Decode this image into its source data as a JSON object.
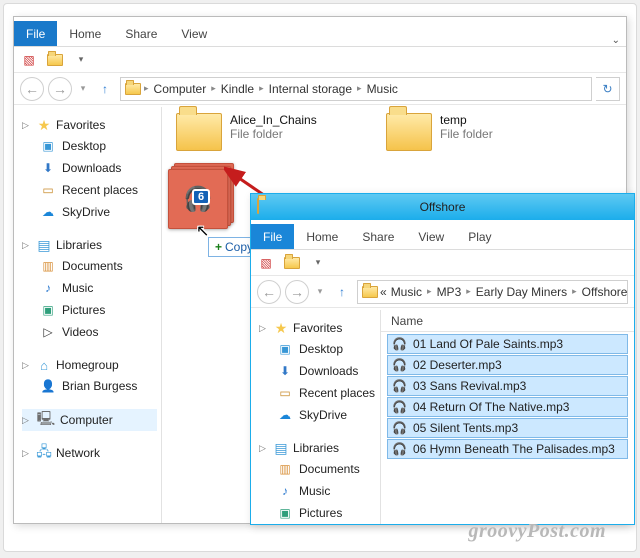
{
  "watermark": "groovyPost.com",
  "main": {
    "ribbon": {
      "file": "File",
      "tabs": [
        "Home",
        "Share",
        "View"
      ]
    },
    "address": [
      "Computer",
      "Kindle",
      "Internal storage",
      "Music"
    ],
    "nav": {
      "favorites": {
        "label": "Favorites",
        "items": [
          "Desktop",
          "Downloads",
          "Recent places",
          "SkyDrive"
        ]
      },
      "libraries": {
        "label": "Libraries",
        "items": [
          "Documents",
          "Music",
          "Pictures",
          "Videos"
        ]
      },
      "homegroup": {
        "label": "Homegroup",
        "items": [
          "Brian Burgess"
        ]
      },
      "computer": {
        "label": "Computer"
      },
      "network": {
        "label": "Network"
      }
    },
    "tiles": [
      {
        "name": "Alice_In_Chains",
        "kind": "File folder"
      },
      {
        "name": "temp",
        "kind": "File folder"
      }
    ],
    "drag": {
      "count": "6",
      "hint": "Copy"
    }
  },
  "sub": {
    "title": "Offshore",
    "ribbon": {
      "file": "File",
      "tabs": [
        "Home",
        "Share",
        "View",
        "Play"
      ]
    },
    "address_prefix": "«",
    "address": [
      "Music",
      "MP3",
      "Early Day Miners",
      "Offshore"
    ],
    "col": "Name",
    "nav": {
      "favorites": {
        "label": "Favorites",
        "items": [
          "Desktop",
          "Downloads",
          "Recent places",
          "SkyDrive"
        ]
      },
      "libraries": {
        "label": "Libraries",
        "items": [
          "Documents",
          "Music",
          "Pictures"
        ]
      }
    },
    "files": [
      "01 Land Of Pale Saints.mp3",
      "02 Deserter.mp3",
      "03 Sans Revival.mp3",
      "04 Return Of The Native.mp3",
      "05 Silent Tents.mp3",
      "06 Hymn Beneath The Palisades.mp3"
    ]
  }
}
